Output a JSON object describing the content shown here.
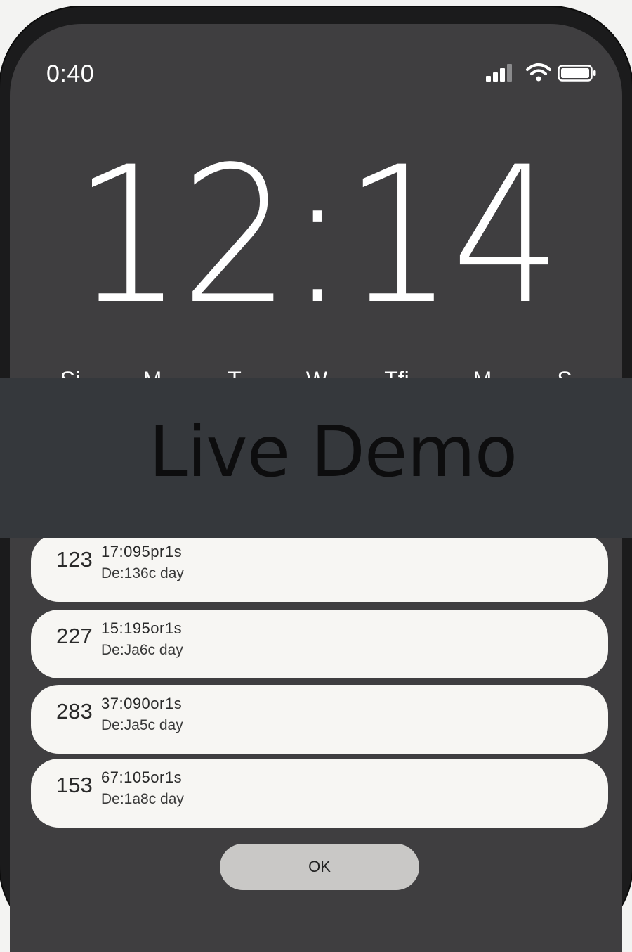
{
  "status_bar": {
    "time": "0:40",
    "signal_icon": "cellular-signal-icon",
    "wifi_icon": "wifi-icon",
    "battery_icon": "battery-icon"
  },
  "clock": {
    "time": "12:14"
  },
  "week": {
    "days": [
      "Si",
      "M",
      "T",
      "W",
      "Tfi",
      "M",
      "S"
    ]
  },
  "overlay": {
    "label": "Live Demo"
  },
  "alarms": [
    {
      "count": "123",
      "time": "17:095pr1s",
      "detail": "De:136c day"
    },
    {
      "count": "227",
      "time": "15:195or1s",
      "detail": "De:Ja6c day"
    },
    {
      "count": "283",
      "time": "37:090or1s",
      "detail": "De:Ja5c day"
    },
    {
      "count": "153",
      "time": "67:105or1s",
      "detail": "De:1a8c day"
    }
  ],
  "actions": {
    "ok_label": "OK"
  },
  "colors": {
    "screen_bg": "#3f3e40",
    "card_bg": "#f7f6f3",
    "banner_bg": "#35383c",
    "button_bg": "#c9c8c6"
  }
}
